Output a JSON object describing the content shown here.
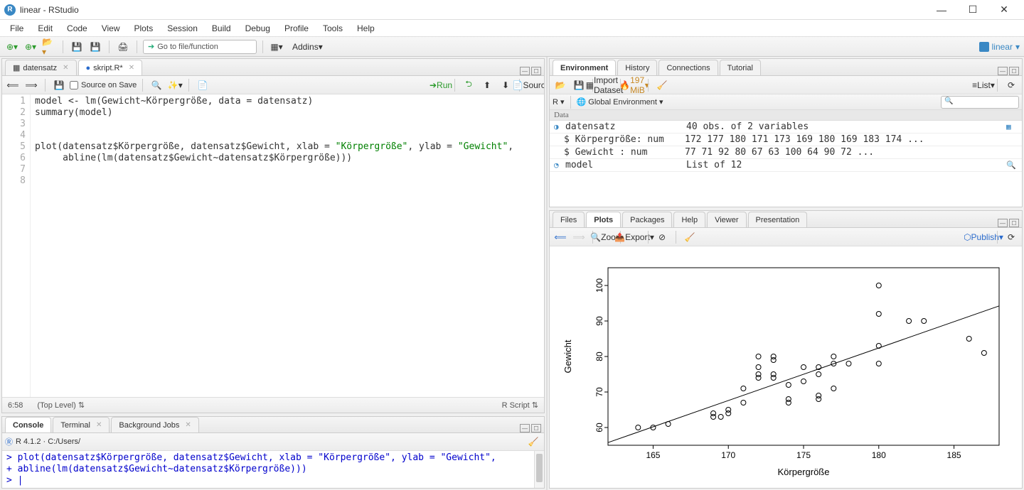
{
  "window": {
    "title": "linear - RStudio",
    "project_name": "linear"
  },
  "menu": [
    "File",
    "Edit",
    "Code",
    "View",
    "Plots",
    "Session",
    "Build",
    "Debug",
    "Profile",
    "Tools",
    "Help"
  ],
  "main_toolbar": {
    "goto_placeholder": "Go to file/function",
    "addins_label": "Addins"
  },
  "source": {
    "tabs": [
      {
        "label": "datensatz",
        "active": false
      },
      {
        "label": "skript.R*",
        "active": true
      }
    ],
    "toolbar": {
      "source_on_save": "Source on Save",
      "run": "Run",
      "source_btn": "Source"
    },
    "code_lines": [
      "model <- lm(Gewicht~Körpergröße, data = datensatz)",
      "summary(model)",
      "",
      "",
      "plot(datensatz$Körpergröße, datensatz$Gewicht, xlab = \"Körpergröße\", ylab = \"Gewicht\",",
      "     abline(lm(datensatz$Gewicht~datensatz$Körpergröße)))",
      "",
      ""
    ],
    "status": {
      "cursor": "6:58",
      "scope": "(Top Level)",
      "lang": "R Script"
    }
  },
  "console": {
    "tabs": [
      "Console",
      "Terminal",
      "Background Jobs"
    ],
    "version_path": "R 4.1.2 · C:/Users/",
    "lines": [
      "> plot(datensatz$Körpergröße, datensatz$Gewicht, xlab = \"Körpergröße\", ylab = \"Gewicht\",",
      "+      abline(lm(datensatz$Gewicht~datensatz$Körpergröße)))",
      "> |"
    ]
  },
  "env": {
    "tabs": [
      "Environment",
      "History",
      "Connections",
      "Tutorial"
    ],
    "toolbar": {
      "import": "Import Dataset",
      "memory": "197 MiB",
      "list": "List"
    },
    "scope": {
      "lang": "R",
      "env": "Global Environment"
    },
    "section": "Data",
    "rows": [
      {
        "name": "datensatz",
        "value": "40 obs. of 2 variables",
        "expandable": true,
        "icon": "table"
      },
      {
        "name": "  $ Körpergröße: num",
        "value": "172 177 180 171 173 169 180 169 183 174 ...",
        "sub": true
      },
      {
        "name": "  $ Gewicht    : num",
        "value": "77 71 92 80 67 63 100 64 90 72 ...",
        "sub": true
      },
      {
        "name": "model",
        "value": "List of 12",
        "icon": "list",
        "inspect": true
      }
    ]
  },
  "plots": {
    "tabs": [
      "Files",
      "Plots",
      "Packages",
      "Help",
      "Viewer",
      "Presentation"
    ],
    "toolbar": {
      "zoom": "Zoom",
      "export": "Export",
      "publish": "Publish"
    }
  },
  "chart_data": {
    "type": "scatter",
    "xlabel": "Körpergröße",
    "ylabel": "Gewicht",
    "xlim": [
      162,
      188
    ],
    "ylim": [
      55,
      105
    ],
    "xticks": [
      165,
      170,
      175,
      180,
      185
    ],
    "yticks": [
      60,
      70,
      80,
      90,
      100
    ],
    "points": [
      [
        164,
        60
      ],
      [
        165,
        60
      ],
      [
        166,
        61
      ],
      [
        169,
        63
      ],
      [
        169,
        64
      ],
      [
        169.5,
        63
      ],
      [
        170,
        64
      ],
      [
        170,
        65
      ],
      [
        171,
        67
      ],
      [
        171,
        71
      ],
      [
        172,
        74
      ],
      [
        172,
        75
      ],
      [
        172,
        77
      ],
      [
        172,
        80
      ],
      [
        173,
        74
      ],
      [
        173,
        75
      ],
      [
        173,
        79
      ],
      [
        173,
        80
      ],
      [
        174,
        67
      ],
      [
        174,
        68
      ],
      [
        174,
        72
      ],
      [
        175,
        73
      ],
      [
        175,
        77
      ],
      [
        176,
        68
      ],
      [
        176,
        69
      ],
      [
        176,
        75
      ],
      [
        176,
        77
      ],
      [
        177,
        71
      ],
      [
        177,
        78
      ],
      [
        177,
        80
      ],
      [
        178,
        78
      ],
      [
        180,
        78
      ],
      [
        180,
        83
      ],
      [
        180,
        92
      ],
      [
        180,
        100
      ],
      [
        182,
        90
      ],
      [
        183,
        90
      ],
      [
        186,
        85
      ],
      [
        187,
        81
      ]
    ],
    "abline": {
      "slope": 1.48,
      "intercept": -184
    }
  }
}
